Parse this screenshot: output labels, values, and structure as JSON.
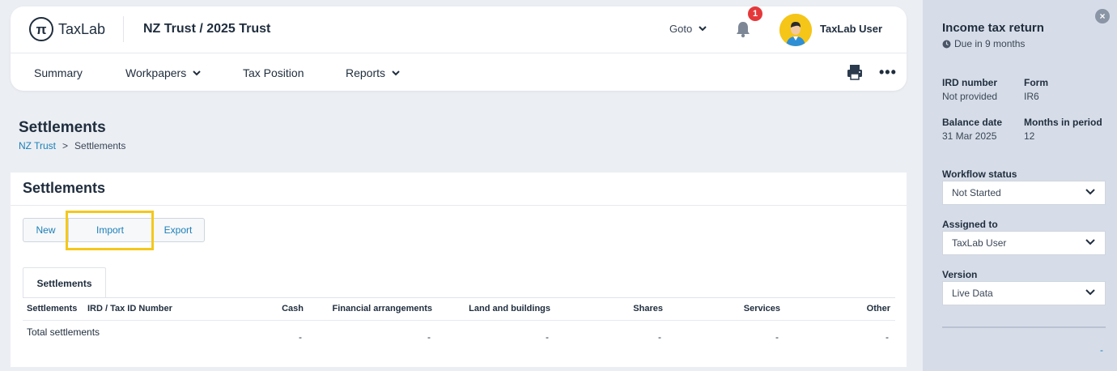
{
  "header": {
    "logo_glyph": "π",
    "logo_text": "TaxLab",
    "entity_title": "NZ Trust / 2025 Trust",
    "goto_label": "Goto",
    "notification_count": "1",
    "user_name": "TaxLab User"
  },
  "nav": {
    "items": [
      {
        "label": "Summary",
        "has_dropdown": false
      },
      {
        "label": "Workpapers",
        "has_dropdown": true
      },
      {
        "label": "Tax Position",
        "has_dropdown": false
      },
      {
        "label": "Reports",
        "has_dropdown": true
      }
    ],
    "more_label": "•••"
  },
  "page": {
    "title": "Settlements",
    "breadcrumb": {
      "root": "NZ Trust",
      "separator": ">",
      "current": "Settlements"
    }
  },
  "card": {
    "title": "Settlements",
    "buttons": {
      "new": "New",
      "import": "Import",
      "export": "Export"
    },
    "tab_label": "Settlements",
    "table": {
      "headers": [
        "Settlements",
        "IRD / Tax ID Number",
        "Cash",
        "Financial arrangements",
        "Land and buildings",
        "Shares",
        "Services",
        "Other"
      ],
      "total_row": {
        "label": "Total settlements",
        "cash": "-",
        "financial_arrangements": "-",
        "land_and_buildings": "-",
        "shares": "-",
        "services": "-",
        "other": "-"
      }
    }
  },
  "side_panel": {
    "close_label": "×",
    "title": "Income tax return",
    "due": "Due in 9 months",
    "ird_number_label": "IRD number",
    "ird_number_value": "Not provided",
    "form_label": "Form",
    "form_value": "IR6",
    "balance_date_label": "Balance date",
    "balance_date_value": "31 Mar 2025",
    "months_label": "Months in period",
    "months_value": "12",
    "workflow_label": "Workflow status",
    "workflow_value": "Not Started",
    "assigned_label": "Assigned to",
    "assigned_value": "TaxLab User",
    "version_label": "Version",
    "version_value": "Live Data",
    "footer_dash": "-"
  },
  "colors": {
    "accent_link": "#1b7fb8",
    "highlight": "#f4c81d",
    "badge": "#e5383b",
    "panel_bg": "#d6dde8"
  }
}
